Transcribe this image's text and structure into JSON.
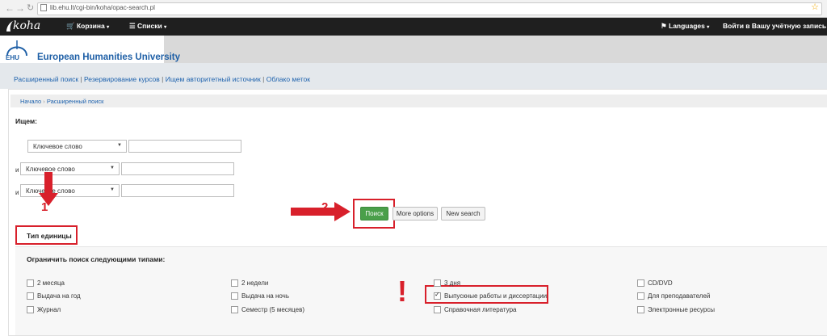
{
  "browser": {
    "url": "lib.ehu.lt/cgi-bin/koha/opac-search.pl"
  },
  "navbar": {
    "logo": "koha",
    "cart": "Корзина",
    "lists": "Списки",
    "languages": "Languages",
    "login": "Войти в Вашу учётную запись"
  },
  "header": {
    "logo_text": "EHU",
    "university": "European Humanities University"
  },
  "quicklinks": [
    "Расширенный поиск",
    "Резервирование курсов",
    "Ищем авторитетный источник",
    "Облако меток"
  ],
  "breadcrumb": [
    "Начало",
    "Расширенный поиск"
  ],
  "search": {
    "heading": "Ищем:",
    "rows": [
      {
        "conj": "",
        "field": "Ключевое слово",
        "value": ""
      },
      {
        "conj": "и",
        "field": "Ключевое слово",
        "value": ""
      },
      {
        "conj": "и",
        "field": "Ключевое слово",
        "value": ""
      }
    ],
    "submit_label": "Поиск",
    "more_options_label": "More options",
    "new_search_label": "New search"
  },
  "annotations": {
    "arrow1_num": "1",
    "arrow2_num": "2",
    "exclamation": "!"
  },
  "itemtype": {
    "heading": "Тип единицы",
    "limit_label": "Ограничить поиск следующими типами:",
    "options": [
      {
        "label": "2 месяца",
        "checked": false
      },
      {
        "label": "2 недели",
        "checked": false
      },
      {
        "label": "3 дня",
        "checked": false
      },
      {
        "label": "CD/DVD",
        "checked": false
      },
      {
        "label": "Выдача на год",
        "checked": false
      },
      {
        "label": "Выдача на ночь",
        "checked": false
      },
      {
        "label": "Выпускные работы и диссертации",
        "checked": true
      },
      {
        "label": "Для преподавателей",
        "checked": false
      },
      {
        "label": "Журнал",
        "checked": false
      },
      {
        "label": "Семестр (5 месяцев)",
        "checked": false
      },
      {
        "label": "Справочная литература",
        "checked": false
      },
      {
        "label": "Электронные ресурсы",
        "checked": false
      }
    ]
  },
  "colors": {
    "accent_red": "#d8202b",
    "primary_button": "#4a9f4a",
    "link": "#1e62ad",
    "navbar": "#1f1f1f"
  }
}
